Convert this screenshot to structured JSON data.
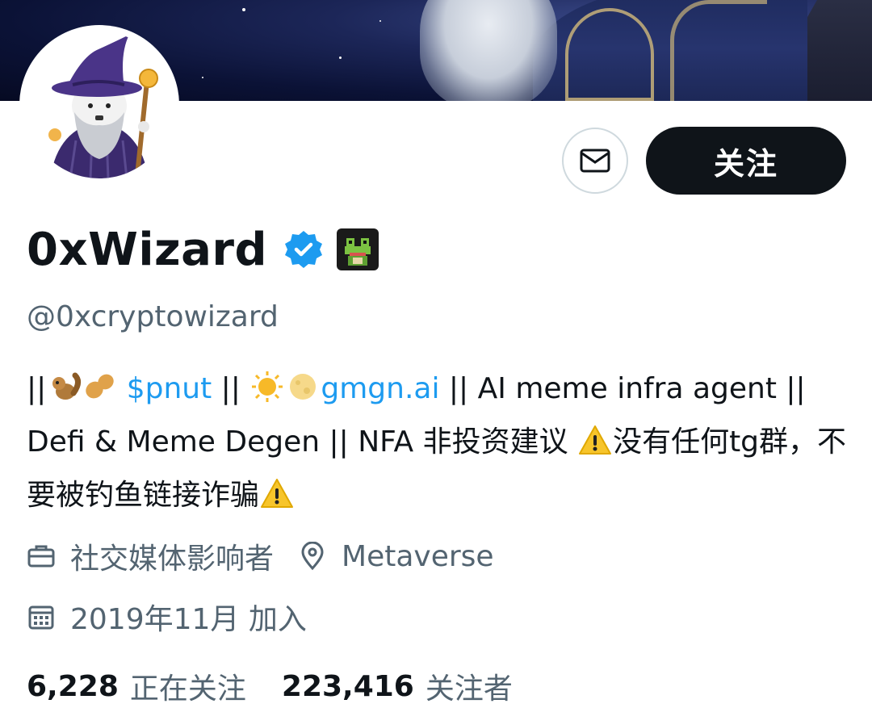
{
  "profile": {
    "display_name": "0xWizard",
    "handle": "@0xcryptowizard",
    "follow_label": "关注",
    "bio": {
      "seg1": "||",
      "ticker": "$pnut",
      "seg2": " || ",
      "link": "gmgn.ai",
      "seg3": " || AI meme infra agent || Defi & Meme Degen  || NFA 非投资建议 ",
      "seg4": "没有任何tg群，不要被钓鱼链接诈骗"
    },
    "category": "社交媒体影响者",
    "location": "Metaverse",
    "joined": "2019年11月 加入",
    "following_count": "6,228",
    "following_label": "正在关注",
    "followers_count": "223,416",
    "followers_label": "关注者"
  },
  "icons": {
    "message": "envelope-icon",
    "verified": "verified-badge-icon",
    "category": "briefcase-icon",
    "location": "location-pin-icon",
    "joined": "calendar-icon"
  },
  "colors": {
    "text": "#0f1419",
    "secondary": "#536471",
    "link": "#1d9bf0",
    "follow_button": "#0f1419",
    "verified": "#1d9bf0"
  }
}
